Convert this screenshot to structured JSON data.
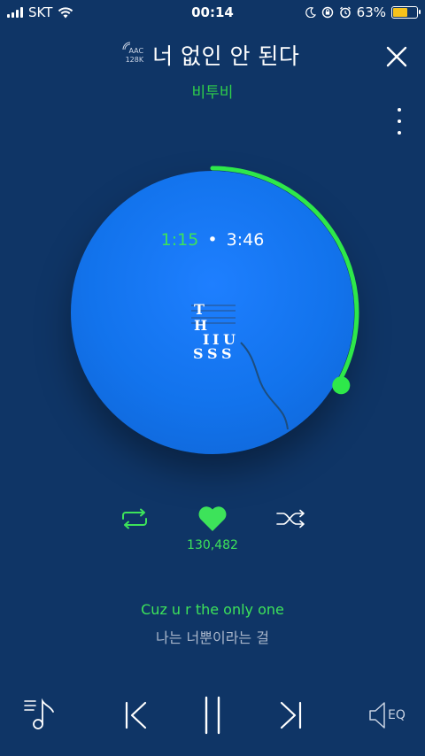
{
  "status_bar": {
    "carrier": "SKT",
    "time": "00:14",
    "battery_percent": "63%",
    "battery_level": 0.63,
    "battery_color": "#f6c21b"
  },
  "player": {
    "quality_codec": "AAC",
    "quality_bitrate": "128K",
    "song_title": "너 없인 안 된다",
    "artist": "비투비",
    "current_time": "1:15",
    "time_separator": "•",
    "total_time": "3:46",
    "progress_fraction": 0.332,
    "like_count": "130,482",
    "album_art_text": "THISSUSS"
  },
  "lyrics": {
    "current": "Cuz u r the only one",
    "next": "나는 너뿐이라는 걸"
  },
  "bottom_bar": {
    "eq_label": "EQ"
  },
  "colors": {
    "background": "#0f3566",
    "accent_green": "#3de35a",
    "disc_blue": "#1273ec"
  }
}
